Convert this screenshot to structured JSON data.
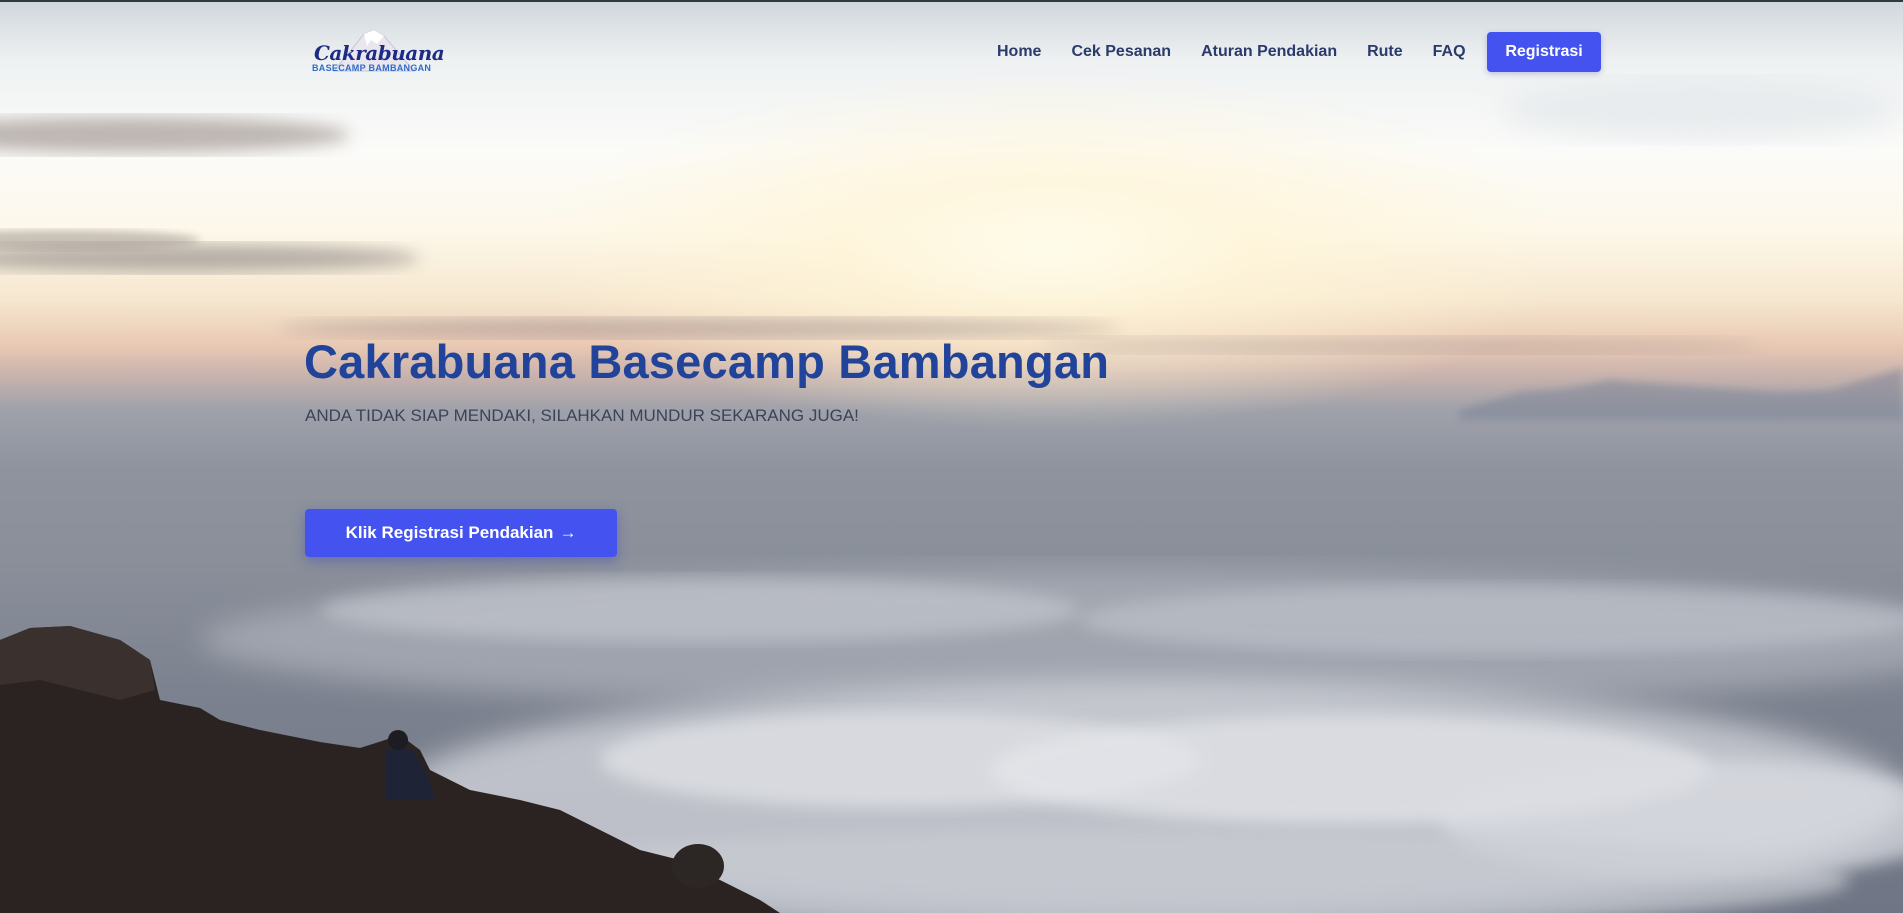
{
  "brand": {
    "logo_title": "Cakrabuana",
    "logo_subtitle": "BASECAMP BAMBANGAN"
  },
  "nav": {
    "items": [
      {
        "label": "Home"
      },
      {
        "label": "Cek Pesanan"
      },
      {
        "label": "Aturan Pendakian"
      },
      {
        "label": "Rute"
      },
      {
        "label": "FAQ"
      }
    ],
    "cta_label": "Registrasi"
  },
  "hero": {
    "title": "Cakrabuana Basecamp Bambangan",
    "subtitle": "ANDA TIDAK SIAP MENDAKI, SILAHKAN MUNDUR SEKARANG JUGA!",
    "cta_label": "Klik Registrasi Pendakian",
    "cta_icon": "arrow-right-icon"
  },
  "colors": {
    "accent": "#4453f0",
    "title": "#21439a",
    "nav_text": "#2a3b6b"
  }
}
